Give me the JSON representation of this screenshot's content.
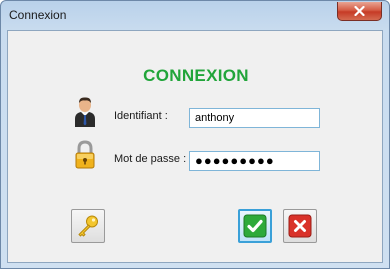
{
  "window": {
    "title": "Connexion"
  },
  "form": {
    "heading": "CONNEXION",
    "username": {
      "label": "Identifiant :",
      "value": "anthony",
      "icon": "user-icon"
    },
    "password": {
      "label": "Mot de passe :",
      "masked_value": "●●●●●●●●●",
      "icon": "padlock-icon"
    }
  },
  "buttons": {
    "key": {
      "icon": "key-icon"
    },
    "ok": {
      "icon": "checkmark-icon",
      "color": "#2eaa3a"
    },
    "cancel": {
      "icon": "x-icon",
      "color": "#d9322a"
    }
  },
  "colors": {
    "heading": "#21a53a",
    "input_border": "#7fb5d8",
    "close_button": "#c63b26"
  }
}
